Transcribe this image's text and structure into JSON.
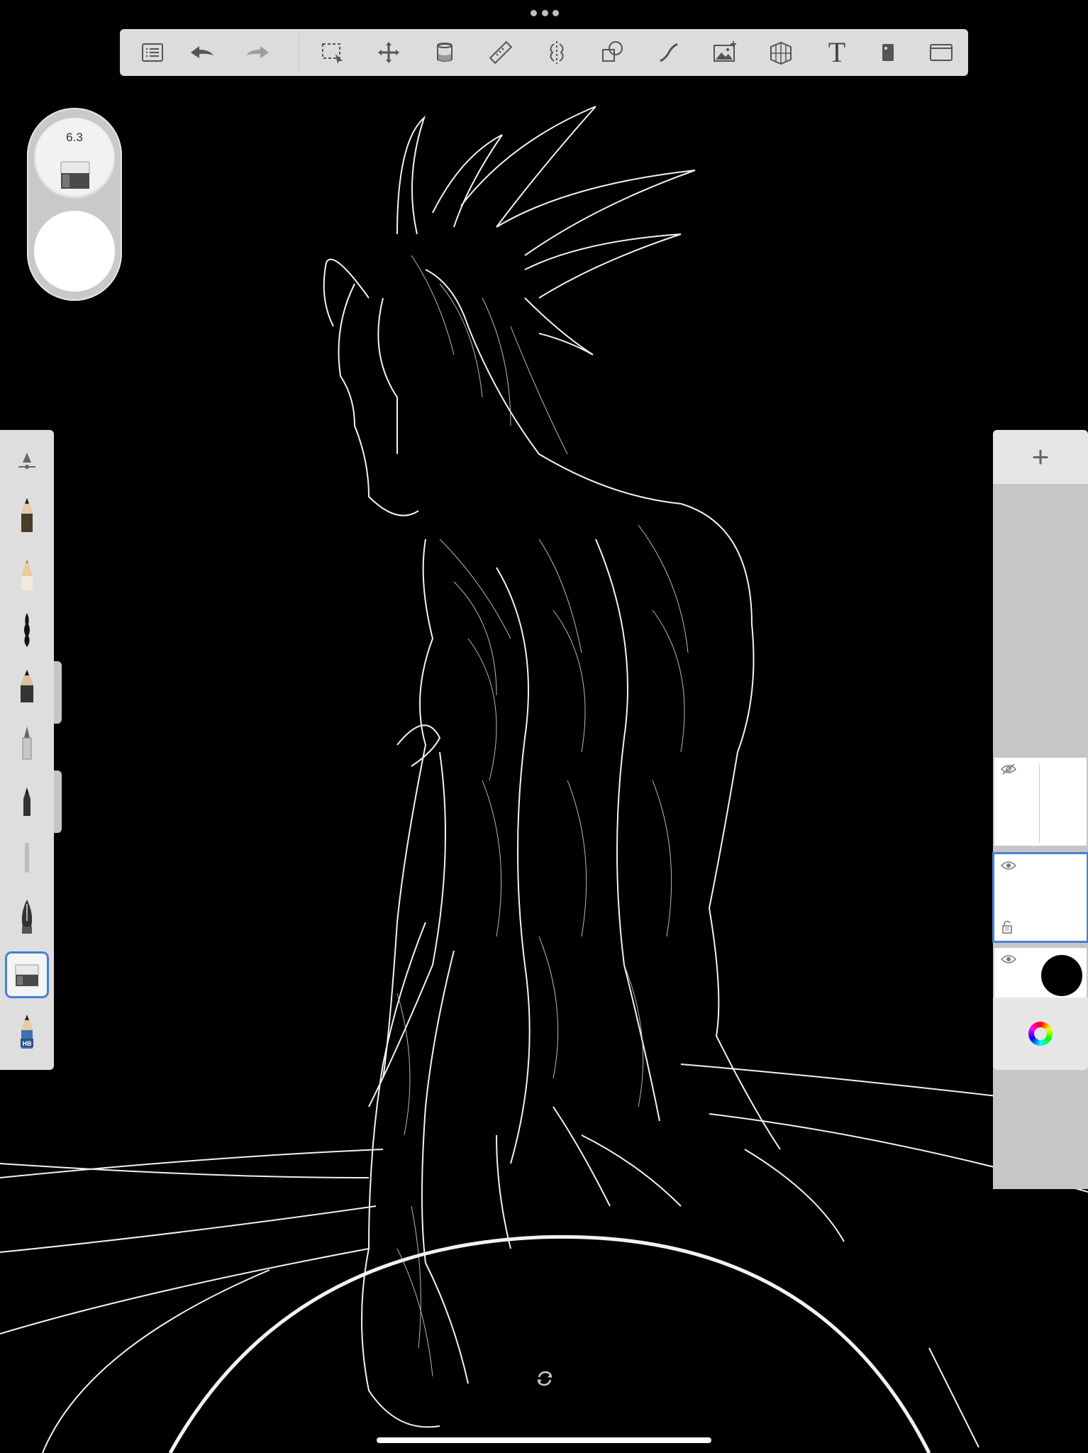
{
  "app": {
    "toolbar_items": [
      {
        "name": "gallery-icon"
      },
      {
        "name": "undo-icon"
      },
      {
        "name": "redo-icon"
      },
      {
        "name": "selection-icon"
      },
      {
        "name": "transform-icon"
      },
      {
        "name": "fill-icon"
      },
      {
        "name": "ruler-icon"
      },
      {
        "name": "symmetry-icon"
      },
      {
        "name": "predictive-stroke-icon"
      },
      {
        "name": "steady-stroke-icon"
      },
      {
        "name": "import-image-icon"
      },
      {
        "name": "perspective-guide-icon"
      },
      {
        "name": "text-icon"
      },
      {
        "name": "brush-library-icon"
      },
      {
        "name": "fullscreen-icon"
      }
    ],
    "text_tool_glyph": "T"
  },
  "brush_puck": {
    "size": "6.3",
    "active_brush": "eraser-icon",
    "color": "#ffffff"
  },
  "brushes": [
    {
      "name": "brush-properties-icon"
    },
    {
      "name": "pencil-icon"
    },
    {
      "name": "soft-pencil-icon"
    },
    {
      "name": "ink-brush-icon"
    },
    {
      "name": "marker-icon"
    },
    {
      "name": "paint-brush-icon"
    },
    {
      "name": "fine-pen-icon"
    },
    {
      "name": "smudge-icon"
    },
    {
      "name": "fountain-pen-icon"
    },
    {
      "name": "eraser-icon",
      "selected": true
    },
    {
      "name": "hb-pencil-icon",
      "label": "HB"
    }
  ],
  "layers": [
    {
      "name": "layer-2",
      "visible": false,
      "selected": false
    },
    {
      "name": "layer-1",
      "visible": true,
      "selected": true,
      "locked": true
    },
    {
      "name": "background-layer",
      "visible": true,
      "color": "#000000"
    }
  ],
  "colors": {
    "accent": "#4a7fd4",
    "panel": "#dedede",
    "canvas": "#000000",
    "stroke": "#ffffff"
  }
}
